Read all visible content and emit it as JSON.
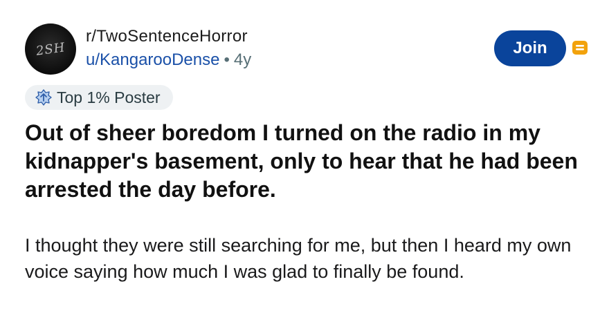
{
  "post": {
    "subreddit": "r/TwoSentenceHorror",
    "username": "u/KangarooDense",
    "separator": "•",
    "age": "4y",
    "avatar_text": "2SH",
    "join_label": "Join",
    "flair": {
      "icon": "top-poster-badge-icon",
      "label": "Top 1% Poster"
    },
    "title": "Out of sheer boredom I turned on the radio in my kidnapper's basement, only to hear that he had been arrested the day before.",
    "body": "I thought they were still searching for me, but then I heard my own voice saying how much I was glad to finally be found."
  },
  "colors": {
    "join_button": "#0a449b",
    "username": "#1a50a8",
    "badge": "#f2a20c",
    "flair_background": "#eef1f3"
  }
}
